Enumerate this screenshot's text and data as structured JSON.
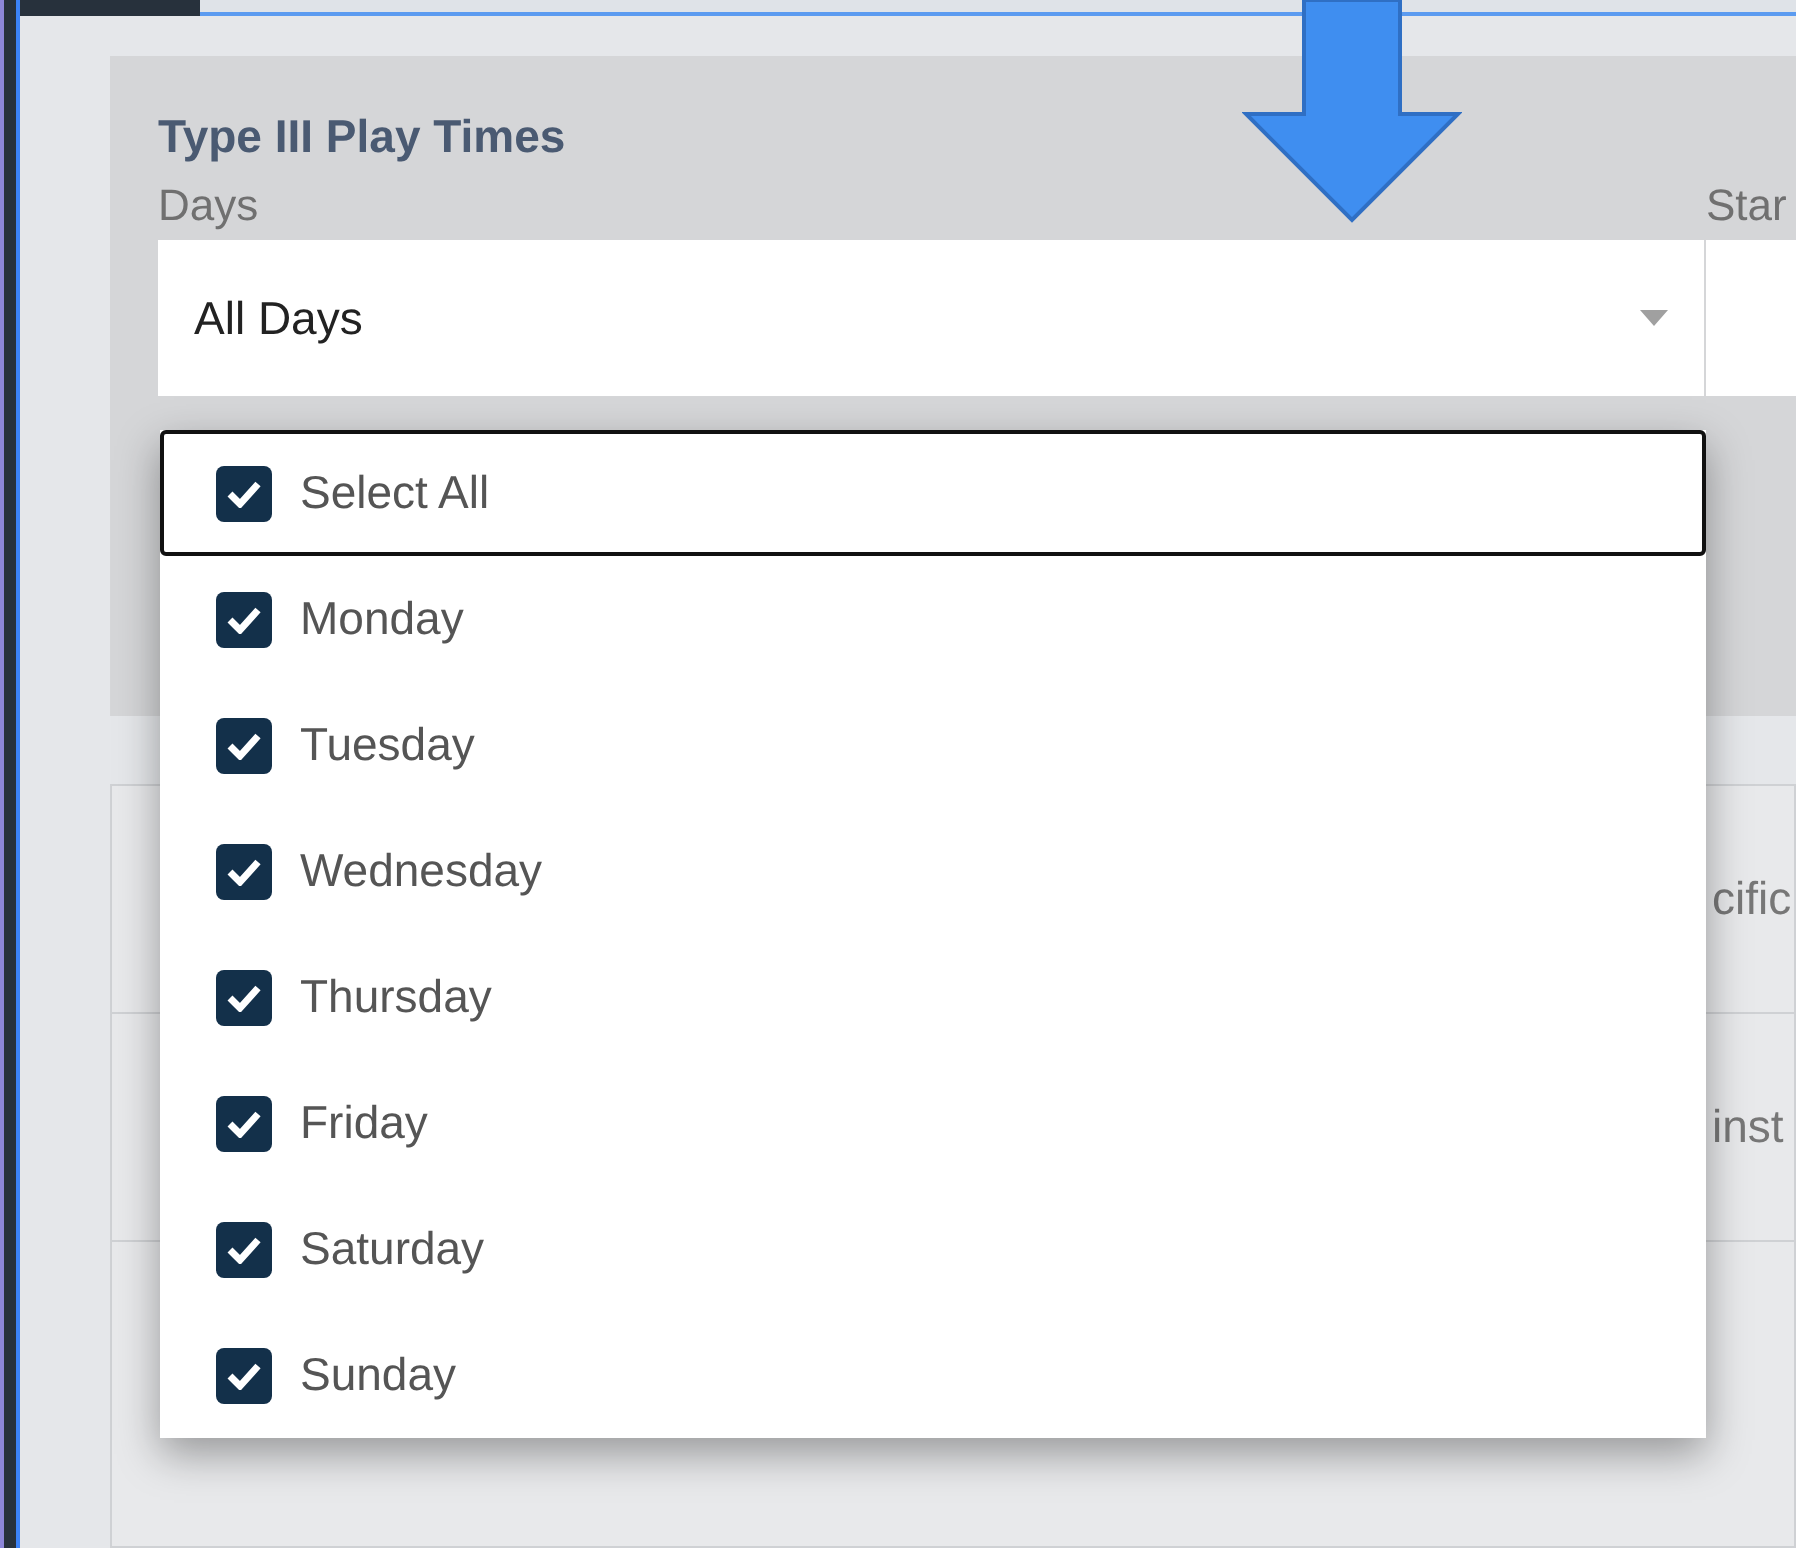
{
  "section": {
    "title": "Type III Play Times",
    "days_label": "Days",
    "days_value": "All Days",
    "next_label": "Star"
  },
  "dropdown": {
    "options": [
      {
        "label": "Select All",
        "checked": true,
        "selected": true
      },
      {
        "label": "Monday",
        "checked": true,
        "selected": false
      },
      {
        "label": "Tuesday",
        "checked": true,
        "selected": false
      },
      {
        "label": "Wednesday",
        "checked": true,
        "selected": false
      },
      {
        "label": "Thursday",
        "checked": true,
        "selected": false
      },
      {
        "label": "Friday",
        "checked": true,
        "selected": false
      },
      {
        "label": "Saturday",
        "checked": true,
        "selected": false
      },
      {
        "label": "Sunday",
        "checked": true,
        "selected": false
      }
    ]
  },
  "card": {
    "rows": [
      "cific",
      "inst"
    ]
  }
}
